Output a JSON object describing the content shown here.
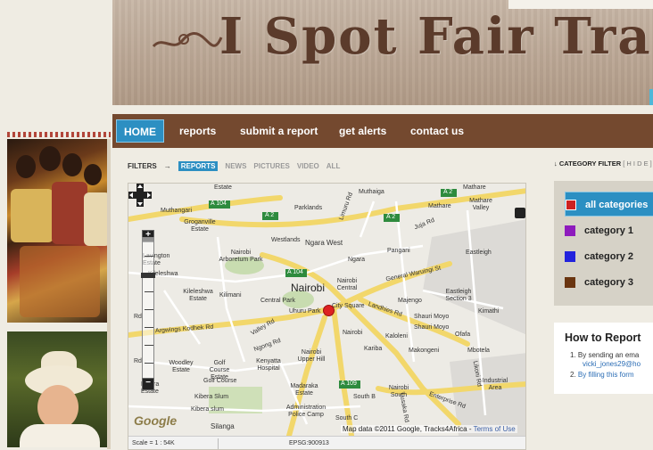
{
  "banner": {
    "title": "I Spot Fair Trade"
  },
  "nav": {
    "items": [
      {
        "label": "HOME"
      },
      {
        "label": "reports"
      },
      {
        "label": "submit a report"
      },
      {
        "label": "get alerts"
      },
      {
        "label": "contact us"
      }
    ]
  },
  "filters": {
    "label": "FILTERS",
    "items": [
      "REPORTS",
      "NEWS",
      "PICTURES",
      "VIDEO",
      "ALL"
    ]
  },
  "map": {
    "labels": {
      "muthangari": "Muthangari",
      "parklands": "Parklands",
      "mathare": "Mathare",
      "mathare2": "Mathare",
      "mathare_valley": "Mathare Valley",
      "muthaiga": "Muthaiga",
      "groganville": "Groganville Estate",
      "westlands": "Westlands",
      "ngara_west": "Ngara West",
      "pangani": "Pangani",
      "eastleigh": "Eastleigh",
      "lavington": "Lavington Estate",
      "arboretum": "Nairobi Arboretum Park",
      "ngara": "Ngara",
      "general_waruingi": "General Waruingi St",
      "kileleshwa": "Kileleshwa",
      "nairobi_big": "Nairobi",
      "nairobi_central": "Nairobi Central",
      "kileleshwa_estate": "Kileleshwa Estate",
      "kilimani": "Kilimani",
      "central_park": "Central Park",
      "majengo": "Majengo",
      "eastleigh_s3": "Eastleigh Section 3",
      "city_square": "City Square",
      "uhuru_park": "Uhuru Park",
      "shauri_moyo": "Shauri Moyo",
      "shauri_moyo2": "Shauri Moyo",
      "kimathi": "Kimathi",
      "argwings": "Argwings Kodhek Rd",
      "nairobi_small": "Nairobi",
      "kaloleni": "Kaloleni",
      "ofafa": "Ofafa",
      "kariba": "Kariba",
      "makongeni": "Makongeni",
      "mbotela": "Mbotela",
      "woodley": "Woodley Estate",
      "golf1": "Golf Course Estate",
      "kenyatta": "Kenyatta Hospital",
      "upper_hill": "Nairobi Upper Hill",
      "golf2": "Golf Course",
      "kibera_slum": "Kibera Slum",
      "madaraka": "Madaraka Estate",
      "nairobi_south": "Nairobi South",
      "south_b": "South B",
      "industrial": "Industrial Area",
      "kibera": "Kibera slum",
      "admin_police": "Administration Police Camp",
      "silanga": "Silanga",
      "south_c": "South C",
      "road_a104": "A 104",
      "road_a2": "A 2",
      "road_a2b": "A 2",
      "road_a2c": "A 2",
      "road_a104b": "A 104",
      "road_a109": "A 109",
      "enterprise": "Enterprise Rd",
      "lusaka": "Lusaka Rd",
      "juja": "Juja Rd",
      "landhies": "Landhies Rd",
      "valley": "Valley Rd",
      "ngong": "Ngong Rd",
      "likoni": "Likoni Rd",
      "limuru": "Limuru Rd",
      "rd1": "Rd",
      "rd2": "Rd",
      "estate_top": "Estate",
      "kibera_top": "Kibera",
      "estate_left": "Estate"
    },
    "google_logo": "Google",
    "copyright": "Map data ©2011 Google, Tracks4Africa - ",
    "terms": "Terms of Use",
    "scale": "Scale = 1 : 54K",
    "epsg": "EPSG:900913",
    "marker_color": "#dd2222"
  },
  "category_filter": {
    "title": "↓ CATEGORY FILTER",
    "hide": "[ H I D E ]",
    "items": [
      {
        "label": "all categories",
        "color": "#cc2222"
      },
      {
        "label": "category 1",
        "color": "#8e1bbd"
      },
      {
        "label": "category 2",
        "color": "#2222dd"
      },
      {
        "label": "category 3",
        "color": "#6a3510"
      }
    ]
  },
  "how_to_report": {
    "title": "How to Report",
    "step1": "1.  By sending an ema",
    "email": "vicki_jones29@ho",
    "step2_num": "2.",
    "step2": "By filling this form"
  },
  "colors": {
    "nav_bg": "#74492f",
    "accent": "#2c8fc2",
    "banner_text": "#5b3b2b"
  }
}
